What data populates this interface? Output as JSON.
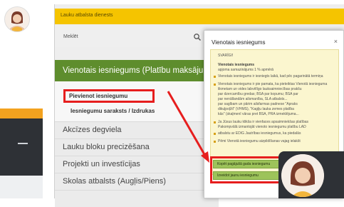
{
  "header": {
    "site_title": "Lauku atbalsta dienests"
  },
  "search": {
    "label": "Meklēt"
  },
  "menu": {
    "active": "Vienotais iesniegums (Platību maksājumi)",
    "submenu": [
      {
        "label": "Pievienot iesniegumu"
      },
      {
        "label": "Iesniegumu saraksts / Izdrukas"
      }
    ],
    "items": [
      {
        "label": "Akcīzes degviela"
      },
      {
        "label": "Lauku bloku precizēšana"
      },
      {
        "label": "Projekti un investīcijas"
      },
      {
        "label": "Skolas atbalsts (Augļis/Piens)"
      }
    ]
  },
  "modal": {
    "title": "Vienotais iesniegums",
    "close": "×",
    "intro": "SVARĪGI!",
    "heading": "Vienotais iesniegums",
    "subheading": "apjoma samazinājums 1 % apmērā",
    "lines": [
      "Vienotais iesniegums ir iesniegts laikā, kad pēc pagarinātā termiņa",
      "Vienotais iesniegums ir pie pamata, ka pieteiktas Vienotā iesnieguma",
      "likmetam un vides labvēlīgo lauksaimniecības prakšu",
      "par dzercamību gredas; BSA par kopumu; BSA par",
      "par nenāllandām ailsmanība, SLA atbalsts...",
      "par saglbam un pārim ailsfarmas padnese \"Apraks",
      "dikuļpoļžil\" (VHMS), \"Kaglju lauka zemes platība",
      "kās\" (skaļmenī vāras pret BSA, PRA izmeklējuma...",
      "Ja Jūsus lauku klikša ir vienfaces apsaimniekšas platības",
      "Pakompvālā izmantojāt vienoto iesniegumu platību LAD",
      "atbalstu ar EDIG Jautrības iesniegumus, ka piedalās",
      "Pēmi Vienotā iesniegumu aizpildīšanas vajag ielakšt"
    ],
    "buttons": [
      {
        "label": "Kopēt pagājušā gada iesniegumu"
      },
      {
        "label": "Izveidot jaunu iesniegumu"
      }
    ]
  },
  "colors": {
    "header": "#f5c400",
    "menu_active": "#5e8d2d",
    "highlight": "#e61e1e",
    "modal_body": "#fbf6cf",
    "modal_button": "#9dc35a"
  },
  "icons": {
    "search": "search-icon",
    "avatar": "user-avatar-icon",
    "arrow": "red-arrow-icon"
  }
}
